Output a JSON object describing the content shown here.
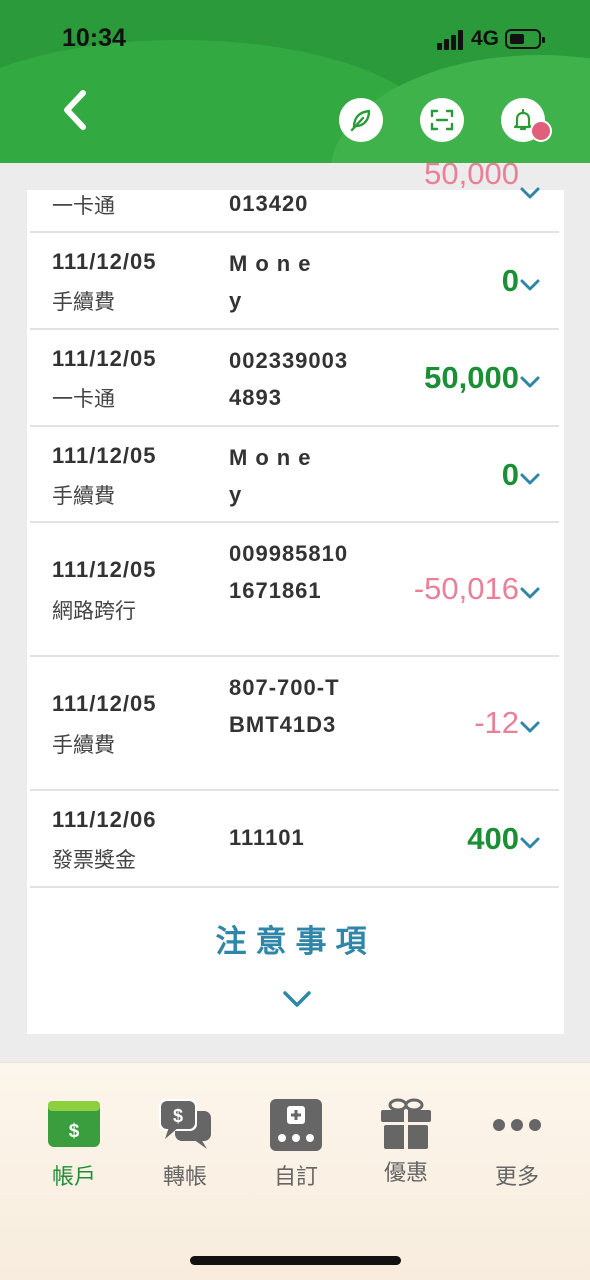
{
  "status_bar": {
    "time": "10:34",
    "network": "4G"
  },
  "header": {
    "back_icon": "chevron-left-icon",
    "actions": [
      "leaf-icon",
      "scan-icon",
      "bell-icon"
    ]
  },
  "colors": {
    "brand_green": "#2b9a3a",
    "positive": "#1a8f35",
    "negative": "#e98097",
    "notice": "#2f86a8"
  },
  "transactions": [
    {
      "date": "",
      "type": "一卡通",
      "account": "013420",
      "amount": "50,000"
    },
    {
      "date": "111/12/05",
      "type": "手續費",
      "account": "Mone y",
      "amount": "0"
    },
    {
      "date": "111/12/05",
      "type": "一卡通",
      "account": "0023390034893",
      "amount": "50,000"
    },
    {
      "date": "111/12/05",
      "type": "手續費",
      "account": "Mone y",
      "amount": "0"
    },
    {
      "date": "111/12/05",
      "type": "網路跨行",
      "account": "0099858101671861",
      "amount": "-50,016"
    },
    {
      "date": "111/12/05",
      "type": "手續費",
      "account": "807-700-TBMT41D3",
      "amount": "-12"
    },
    {
      "date": "111/12/06",
      "type": "發票獎金",
      "account": "111101",
      "amount": "400"
    }
  ],
  "notice": {
    "title": "注意事項"
  },
  "tabs": [
    {
      "label": "帳戶",
      "icon": "wallet-icon"
    },
    {
      "label": "轉帳",
      "icon": "chat-transfer-icon"
    },
    {
      "label": "自訂",
      "icon": "custom-icon"
    },
    {
      "label": "優惠",
      "icon": "gift-icon"
    },
    {
      "label": "更多",
      "icon": "more-icon"
    }
  ]
}
